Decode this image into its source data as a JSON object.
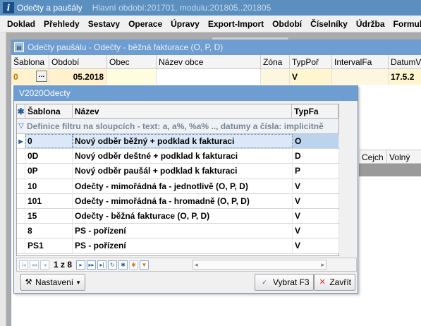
{
  "main_window": {
    "title": "Odečty a paušály",
    "period_info": "Hlavní období:201701, modulu:201805..201805"
  },
  "menu": [
    "Doklad",
    "Přehledy",
    "Sestavy",
    "Operace",
    "Úpravy",
    "Export-Import",
    "Období",
    "Číselníky",
    "Údržba",
    "Formuláře"
  ],
  "child_window": {
    "title": "Odečty paušálu - Odečty - běžná fakturace  (O, P, D)",
    "columns": [
      "Šablona",
      "Období",
      "Obec",
      "Název obce",
      "Zóna",
      "TypPoř",
      "IntervalFa",
      "DatumV"
    ],
    "row": {
      "sablona": "0",
      "ellipsis": "...",
      "obdobi": "05.2018",
      "obec": "",
      "nazev_obce": "",
      "zona": "",
      "typ_por": "V",
      "interval_fa": "",
      "datum": "17.5.2"
    },
    "right_columns": [
      "Cejch",
      "Volný"
    ]
  },
  "popup": {
    "title": "V2020Odecty",
    "columns": [
      "Šablona",
      "Název",
      "TypFa"
    ],
    "filter_hint": "Definice filtru na sloupcích - text: a, a%, %a% .., datumy a čísla: implicitně",
    "rows": [
      {
        "sablona": "0",
        "nazev": "Nový odběr běžný + podklad k fakturaci",
        "typfa": "O",
        "selected": true
      },
      {
        "sablona": "0D",
        "nazev": "Nový odběr deštné + podklad k fakturaci",
        "typfa": "D",
        "selected": false
      },
      {
        "sablona": "0P",
        "nazev": "Nový odběr paušál + podklad k fakturaci",
        "typfa": "P",
        "selected": false
      },
      {
        "sablona": "10",
        "nazev": "Odečty - mimořádná fa - jednotlivě (O, P, D)",
        "typfa": "V",
        "selected": false
      },
      {
        "sablona": "101",
        "nazev": "Odečty - mimořádná fa - hromadně (O, P, D)",
        "typfa": "V",
        "selected": false
      },
      {
        "sablona": "15",
        "nazev": "Odečty - běžná fakturace  (O, P, D)",
        "typfa": "V",
        "selected": false
      },
      {
        "sablona": "8",
        "nazev": "PS - pořízení",
        "typfa": "V",
        "selected": false
      },
      {
        "sablona": "PS1",
        "nazev": "PS - pořízení",
        "typfa": "V",
        "selected": false
      }
    ],
    "pager": "1 z 8",
    "buttons": {
      "settings": "Nastavení",
      "select": "Vybrat F3",
      "close": "Zavřít"
    }
  }
}
